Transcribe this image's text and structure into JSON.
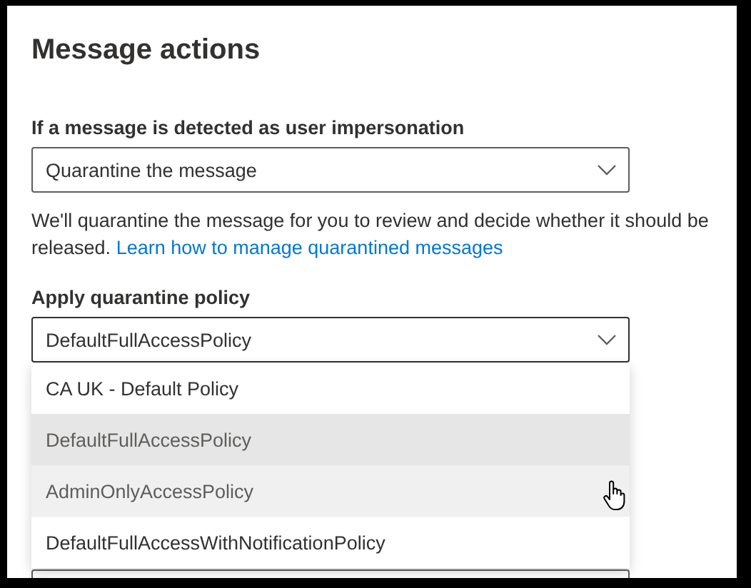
{
  "title": "Message actions",
  "impersonation": {
    "label": "If a message is detected as user impersonation",
    "value": "Quarantine the message"
  },
  "description": {
    "text": "We'll quarantine the message for you to review and decide whether it should be released.",
    "link": "Learn how to manage quarantined messages"
  },
  "quarantine_policy": {
    "label": "Apply quarantine policy",
    "value": "DefaultFullAccessPolicy",
    "expanded": true,
    "options": [
      {
        "label": "CA UK - Default Policy",
        "selected": false,
        "hovered": false
      },
      {
        "label": "DefaultFullAccessPolicy",
        "selected": true,
        "hovered": false
      },
      {
        "label": "AdminOnlyAccessPolicy",
        "selected": false,
        "hovered": true
      },
      {
        "label": "DefaultFullAccessWithNotificationPolicy",
        "selected": false,
        "hovered": false
      }
    ]
  }
}
